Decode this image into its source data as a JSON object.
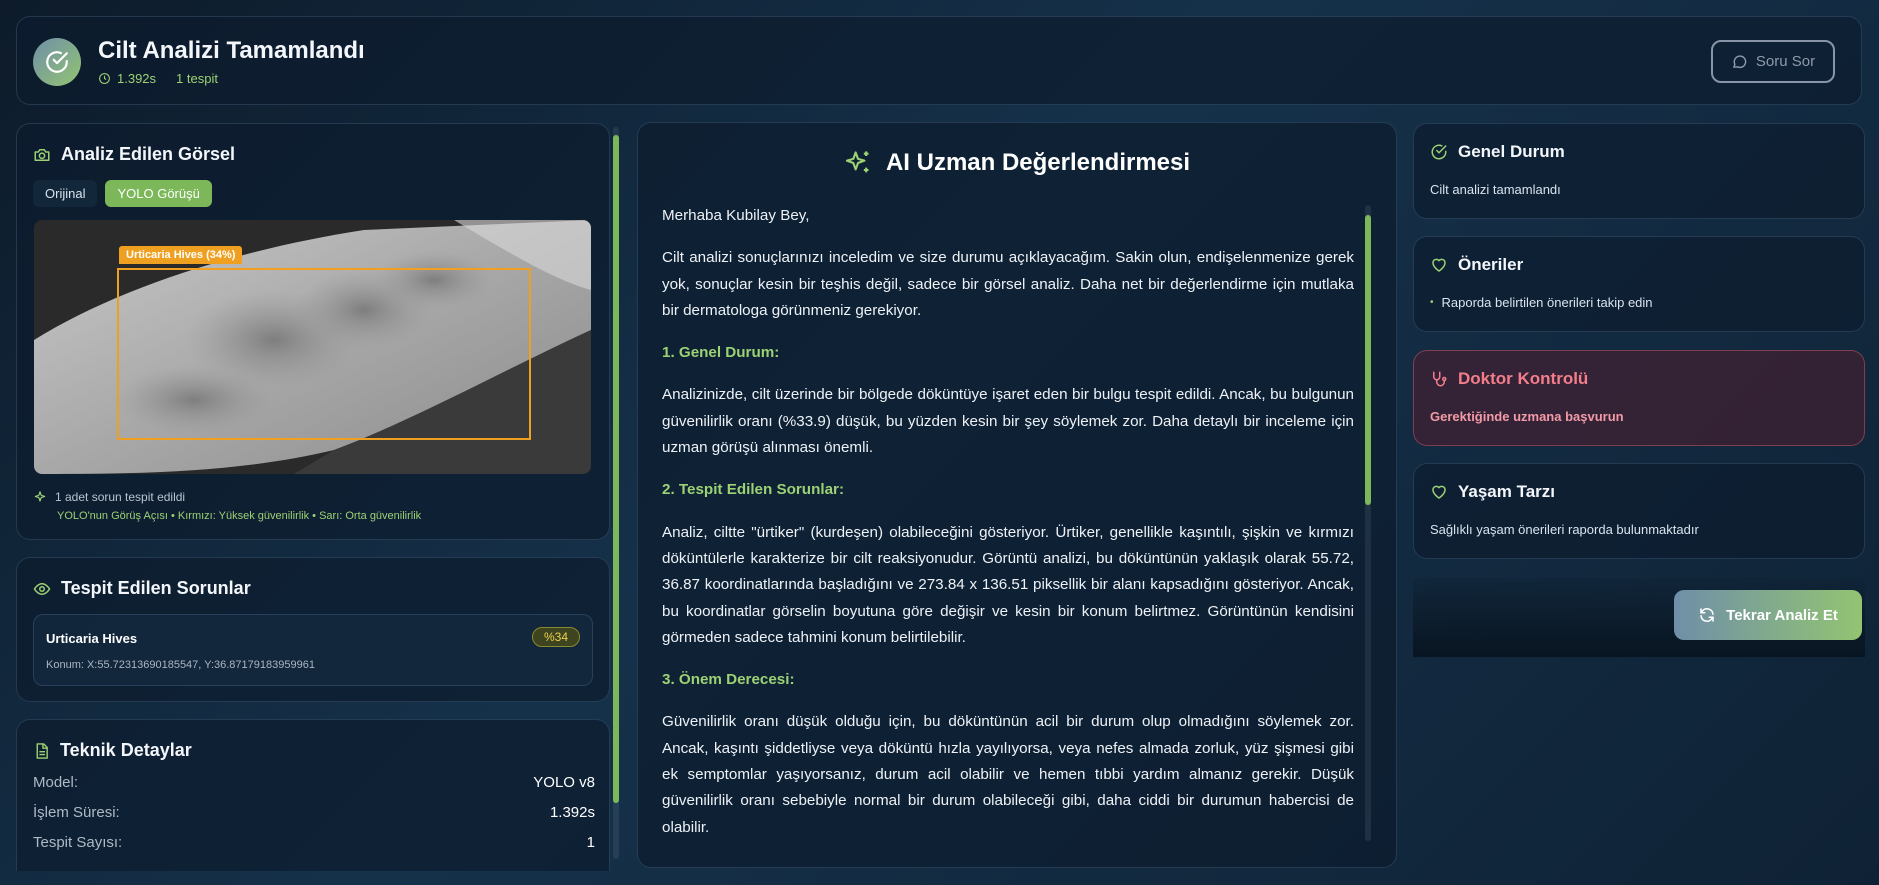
{
  "header": {
    "title": "Cilt Analizi Tamamlandı",
    "duration": "1.392s",
    "detections": "1 tespit",
    "ask_button": "Soru Sor"
  },
  "image_panel": {
    "title": "Analiz Edilen Görsel",
    "tabs": [
      "Orijinal",
      "YOLO Görüşü"
    ],
    "active_tab": "YOLO Görüşü",
    "box_label": "Urticaria Hives (34%)",
    "summary": "1 adet sorun tespit edildi",
    "legend": "YOLO'nun Görüş Açısı • Kırmızı: Yüksek güvenilirlik • Sarı: Orta güvenilirlik"
  },
  "issues_panel": {
    "title": "Tespit Edilen Sorunlar",
    "items": [
      {
        "name": "Urticaria Hives",
        "confidence": "%34",
        "location": "Konum: X:55.72313690185547, Y:36.87179183959961"
      }
    ]
  },
  "tech_panel": {
    "title": "Teknik Detaylar",
    "rows": [
      {
        "key": "Model:",
        "value": "YOLO v8"
      },
      {
        "key": "İşlem Süresi:",
        "value": "1.392s"
      },
      {
        "key": "Tespit Sayısı:",
        "value": "1"
      }
    ]
  },
  "expert": {
    "title": "AI Uzman Değerlendirmesi",
    "greeting": "Merhaba Kubilay Bey,",
    "intro": "Cilt analizi sonuçlarınızı inceledim ve size durumu açıklayacağım. Sakin olun, endişelenmenize gerek yok, sonuçlar kesin bir teşhis değil, sadece bir görsel analiz. Daha net bir değerlendirme için mutlaka bir dermatologa görünmeniz gerekiyor.",
    "h1": "1. Genel Durum:",
    "p1": "Analizinizde, cilt üzerinde bir bölgede döküntüye işaret eden bir bulgu tespit edildi. Ancak, bu bulgunun güvenilirlik oranı (%33.9) düşük, bu yüzden kesin bir şey söylemek zor. Daha detaylı bir inceleme için uzman görüşü alınması önemli.",
    "h2": "2. Tespit Edilen Sorunlar:",
    "p2": "Analiz, ciltte \"ürtiker\" (kurdeşen) olabileceğini gösteriyor. Ürtiker, genellikle kaşıntılı, şişkin ve kırmızı döküntülerle karakterize bir cilt reaksiyonudur. Görüntü analizi, bu döküntünün yaklaşık olarak 55.72, 36.87 koordinatlarında başladığını ve 273.84 x 136.51 piksellik bir alanı kapsadığını gösteriyor. Ancak, bu koordinatlar görselin boyutuna göre değişir ve kesin bir konum belirtmez. Görüntünün kendisini görmeden sadece tahmini konum belirtilebilir.",
    "h3": "3. Önem Derecesi:",
    "p3": "Güvenilirlik oranı düşük olduğu için, bu döküntünün acil bir durum olup olmadığını söylemek zor. Ancak, kaşıntı şiddetliyse veya döküntü hızla yayılıyorsa, veya nefes almada zorluk, yüz şişmesi gibi ek semptomlar yaşıyorsanız, durum acil olabilir ve hemen tıbbi yardım almanız gerekir. Düşük güvenilirlik oranı sebebiyle normal bir durum olabileceği gibi, daha ciddi bir durumun habercisi de olabilir."
  },
  "right": {
    "general": {
      "title": "Genel Durum",
      "text": "Cilt analizi tamamlandı"
    },
    "suggestions": {
      "title": "Öneriler",
      "text": "Raporda belirtilen önerileri takip edin"
    },
    "doctor": {
      "title": "Doktor Kontrolü",
      "text": "Gerektiğinde uzmana başvurun"
    },
    "lifestyle": {
      "title": "Yaşam Tarzı",
      "text": "Sağlıklı yaşam önerileri raporda bulunmaktadır"
    },
    "retry_button": "Tekrar Analiz Et"
  },
  "colors": {
    "accent_green": "#9cd174",
    "box_orange": "#f0a020",
    "doctor_red": "#f47d8b"
  }
}
